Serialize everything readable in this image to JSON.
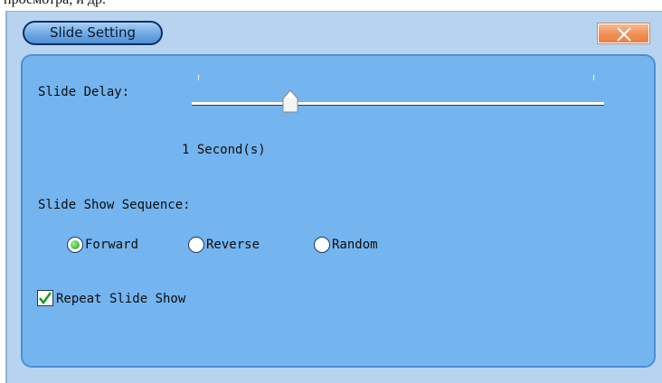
{
  "background_text": "просмотра, и др.",
  "dialog": {
    "title": "Slide Setting",
    "close_icon": "close-x-icon"
  },
  "slide_delay": {
    "label": "Slide Delay:",
    "value_text": "1 Second(s)",
    "slider_fraction": 0.23
  },
  "sequence": {
    "label": "Slide Show Sequence:",
    "options": [
      "Forward",
      "Reverse",
      "Random"
    ],
    "selected": "Forward"
  },
  "repeat": {
    "label": "Repeat Slide Show",
    "checked": true
  },
  "colors": {
    "panel": "#74b4ef",
    "window": "#b7d3ef",
    "close_button": "#f08f55",
    "title_pill": "#6ea8e3"
  }
}
